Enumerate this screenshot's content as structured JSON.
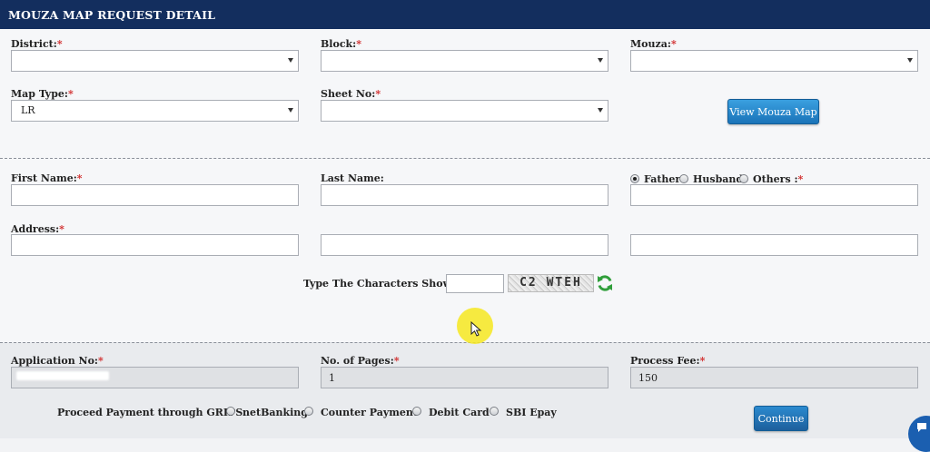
{
  "header": {
    "title": "MOUZA MAP REQUEST DETAIL"
  },
  "location": {
    "district_label": "District:",
    "district_value": "",
    "block_label": "Block:",
    "block_value": "",
    "mouza_label": "Mouza:",
    "mouza_value": "",
    "map_type_label": "Map Type:",
    "map_type_value": "LR",
    "sheet_no_label": "Sheet No:",
    "sheet_no_value": "",
    "view_button_label": "View Mouza Map"
  },
  "applicant": {
    "first_name_label": "First Name:",
    "last_name_label": "Last Name:",
    "relation_options": [
      "Father",
      "Husband",
      "Others :"
    ],
    "relation_selected": "Father",
    "address_label": "Address:",
    "captcha_label": "Type The Characters Shown:",
    "captcha_text": "C2 WTEH"
  },
  "application": {
    "app_no_label": "Application No:",
    "pages_label": "No. of Pages:",
    "pages_value": "1",
    "fee_label": "Process Fee:",
    "fee_value": "150",
    "payment_label": "Proceed Payment through GRIPS:",
    "payment_options": [
      "netBanking",
      "Counter Payment",
      "Debit Card",
      "SBI Epay"
    ],
    "continue_label": "Continue"
  },
  "required_mark": "*",
  "colors": {
    "header_bg": "#132e5e",
    "required": "#d12a2a",
    "button": "#1a73b8",
    "cursor_highlight": "#f6e820"
  }
}
